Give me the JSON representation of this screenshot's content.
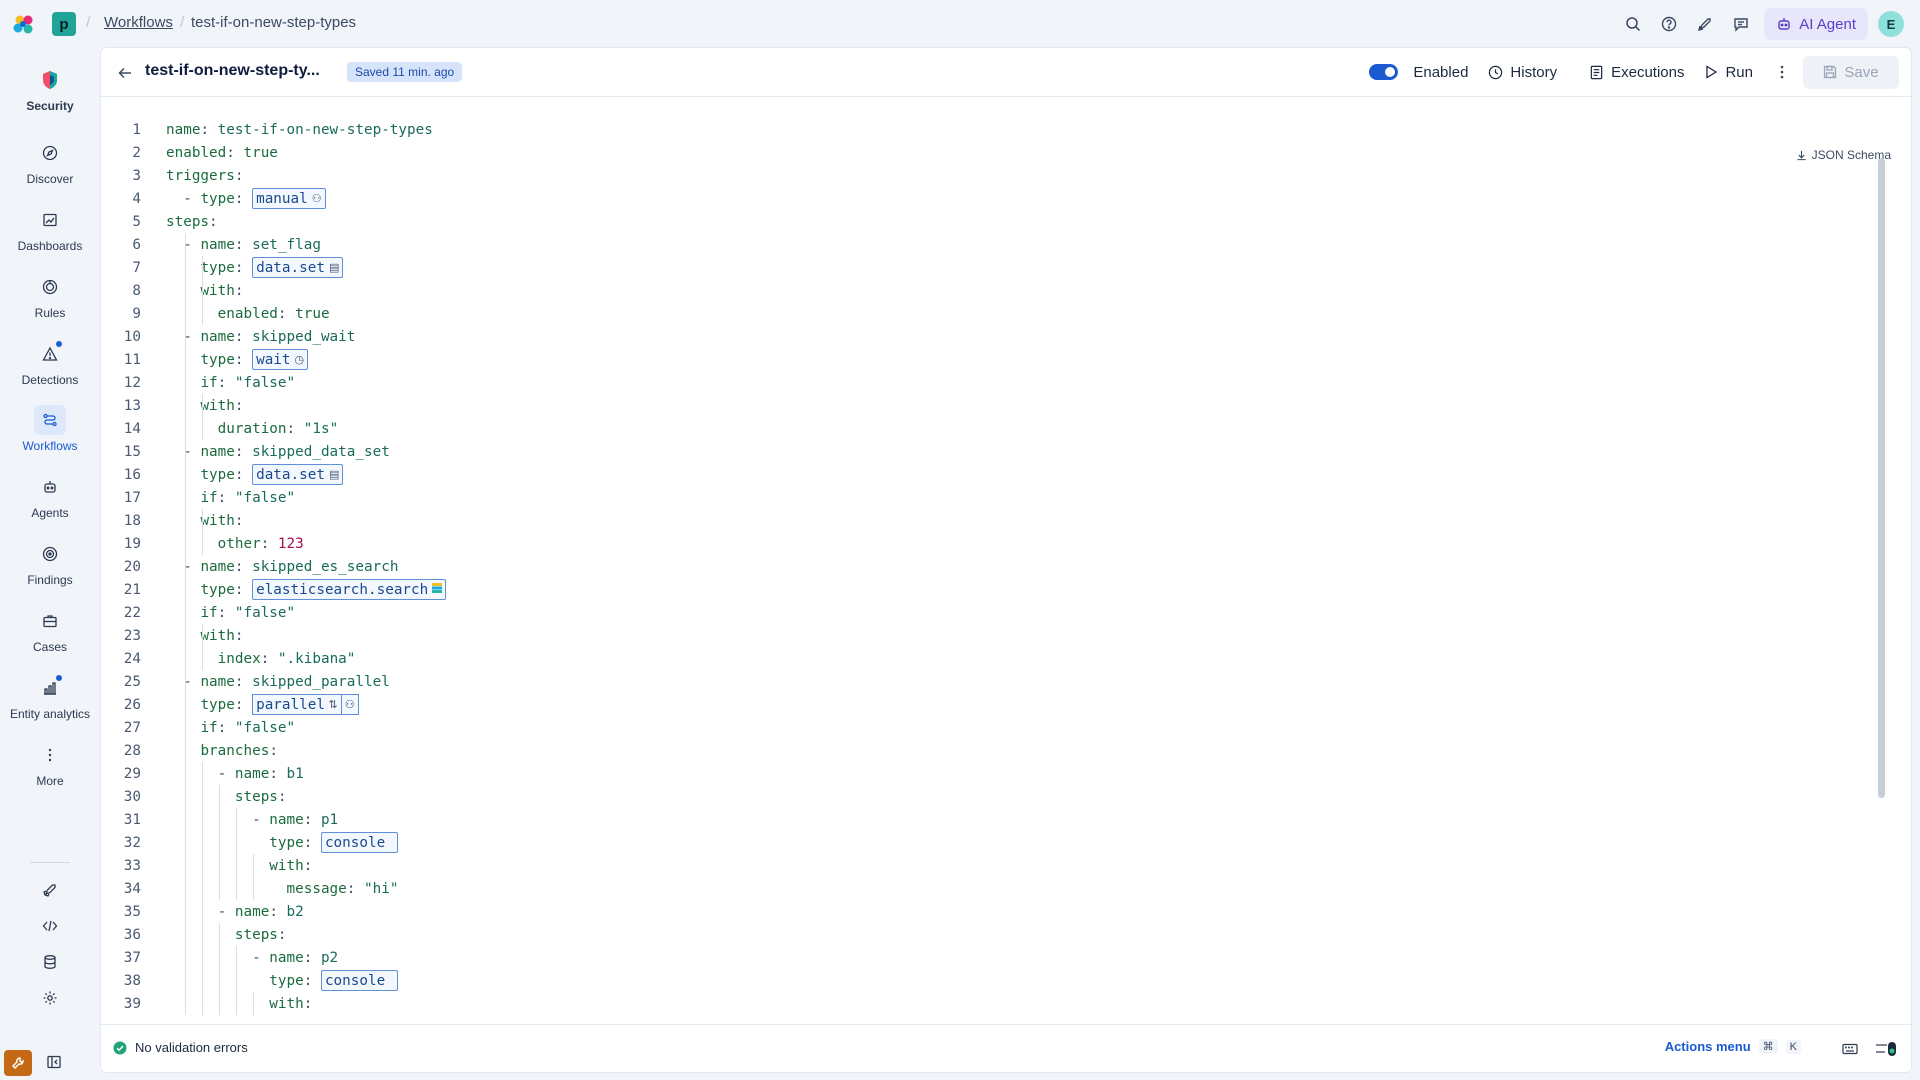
{
  "header": {
    "space_initial": "p",
    "breadcrumbs": [
      "Workflows",
      "test-if-on-new-step-types"
    ],
    "ai_agent_label": "AI Agent",
    "user_initial": "E"
  },
  "sidebar": {
    "items": [
      {
        "label": "Security",
        "icon": "security-shield-icon"
      },
      {
        "label": "Discover",
        "icon": "compass-icon"
      },
      {
        "label": "Dashboards",
        "icon": "dashboard-icon"
      },
      {
        "label": "Rules",
        "icon": "rules-icon"
      },
      {
        "label": "Detections",
        "icon": "warning-icon"
      },
      {
        "label": "Workflows",
        "icon": "workflow-icon"
      },
      {
        "label": "Agents",
        "icon": "robot-icon"
      },
      {
        "label": "Findings",
        "icon": "target-icon"
      },
      {
        "label": "Cases",
        "icon": "briefcase-icon"
      },
      {
        "label": "Entity analytics",
        "icon": "analytics-icon"
      },
      {
        "label": "More",
        "icon": "more-vertical-icon"
      }
    ],
    "active": "Workflows"
  },
  "workflow": {
    "title": "test-if-on-new-step-ty...",
    "saved_status": "Saved 11 min. ago",
    "enabled_label": "Enabled",
    "enabled": true,
    "history_label": "History",
    "executions_label": "Executions",
    "run_label": "Run",
    "save_label": "Save"
  },
  "editor": {
    "json_schema_label": "JSON Schema",
    "lines": [
      {
        "n": "1",
        "tokens": [
          [
            "k",
            "name"
          ],
          [
            "p",
            ": "
          ],
          [
            "s",
            "test-if-on-new-step-types"
          ]
        ]
      },
      {
        "n": "2",
        "tokens": [
          [
            "k",
            "enabled"
          ],
          [
            "p",
            ": "
          ],
          [
            "b",
            "true"
          ]
        ]
      },
      {
        "n": "3",
        "tokens": [
          [
            "k",
            "triggers"
          ],
          [
            "p",
            ":"
          ]
        ]
      },
      {
        "n": "4",
        "tokens": [
          [
            "p",
            "  - "
          ],
          [
            "k",
            "type"
          ],
          [
            "p",
            ": "
          ]
        ],
        "pill": "manual",
        "pill_glyph": "user"
      },
      {
        "n": "5",
        "tokens": [
          [
            "k",
            "steps"
          ],
          [
            "p",
            ":"
          ]
        ]
      },
      {
        "n": "6",
        "tokens": [
          [
            "p",
            "  - "
          ],
          [
            "k",
            "name"
          ],
          [
            "p",
            ": "
          ],
          [
            "s",
            "set_flag"
          ]
        ]
      },
      {
        "n": "7",
        "tokens": [
          [
            "p",
            "    "
          ],
          [
            "k",
            "type"
          ],
          [
            "p",
            ": "
          ]
        ],
        "pill": "data.set",
        "pill_glyph": "db"
      },
      {
        "n": "8",
        "tokens": [
          [
            "p",
            "    "
          ],
          [
            "k",
            "with"
          ],
          [
            "p",
            ":"
          ]
        ]
      },
      {
        "n": "9",
        "tokens": [
          [
            "p",
            "      "
          ],
          [
            "k",
            "enabled"
          ],
          [
            "p",
            ": "
          ],
          [
            "b",
            "true"
          ]
        ]
      },
      {
        "n": "10",
        "tokens": [
          [
            "p",
            "  - "
          ],
          [
            "k",
            "name"
          ],
          [
            "p",
            ": "
          ],
          [
            "s",
            "skipped_wait"
          ]
        ]
      },
      {
        "n": "11",
        "tokens": [
          [
            "p",
            "    "
          ],
          [
            "k",
            "type"
          ],
          [
            "p",
            ": "
          ]
        ],
        "pill": "wait",
        "pill_glyph": "clock"
      },
      {
        "n": "12",
        "tokens": [
          [
            "p",
            "    "
          ],
          [
            "k",
            "if"
          ],
          [
            "p",
            ": "
          ],
          [
            "s",
            "\"false\""
          ]
        ]
      },
      {
        "n": "13",
        "tokens": [
          [
            "p",
            "    "
          ],
          [
            "k",
            "with"
          ],
          [
            "p",
            ":"
          ]
        ]
      },
      {
        "n": "14",
        "tokens": [
          [
            "p",
            "      "
          ],
          [
            "k",
            "duration"
          ],
          [
            "p",
            ": "
          ],
          [
            "s",
            "\"1s\""
          ]
        ]
      },
      {
        "n": "15",
        "tokens": [
          [
            "p",
            "  - "
          ],
          [
            "k",
            "name"
          ],
          [
            "p",
            ": "
          ],
          [
            "s",
            "skipped_data_set"
          ]
        ]
      },
      {
        "n": "16",
        "tokens": [
          [
            "p",
            "    "
          ],
          [
            "k",
            "type"
          ],
          [
            "p",
            ": "
          ]
        ],
        "pill": "data.set",
        "pill_glyph": "db"
      },
      {
        "n": "17",
        "tokens": [
          [
            "p",
            "    "
          ],
          [
            "k",
            "if"
          ],
          [
            "p",
            ": "
          ],
          [
            "s",
            "\"false\""
          ]
        ]
      },
      {
        "n": "18",
        "tokens": [
          [
            "p",
            "    "
          ],
          [
            "k",
            "with"
          ],
          [
            "p",
            ":"
          ]
        ]
      },
      {
        "n": "19",
        "tokens": [
          [
            "p",
            "      "
          ],
          [
            "k",
            "other"
          ],
          [
            "p",
            ": "
          ],
          [
            "n",
            "123"
          ]
        ]
      },
      {
        "n": "20",
        "tokens": [
          [
            "p",
            "  - "
          ],
          [
            "k",
            "name"
          ],
          [
            "p",
            ": "
          ],
          [
            "s",
            "skipped_es_search"
          ]
        ]
      },
      {
        "n": "21",
        "tokens": [
          [
            "p",
            "    "
          ],
          [
            "k",
            "type"
          ],
          [
            "p",
            ": "
          ]
        ],
        "pill": "elasticsearch.search",
        "pill_glyph": "elastic"
      },
      {
        "n": "22",
        "tokens": [
          [
            "p",
            "    "
          ],
          [
            "k",
            "if"
          ],
          [
            "p",
            ": "
          ],
          [
            "s",
            "\"false\""
          ]
        ]
      },
      {
        "n": "23",
        "tokens": [
          [
            "p",
            "    "
          ],
          [
            "k",
            "with"
          ],
          [
            "p",
            ":"
          ]
        ]
      },
      {
        "n": "24",
        "tokens": [
          [
            "p",
            "      "
          ],
          [
            "k",
            "index"
          ],
          [
            "p",
            ": "
          ],
          [
            "s",
            "\".kibana\""
          ]
        ]
      },
      {
        "n": "25",
        "tokens": [
          [
            "p",
            "  - "
          ],
          [
            "k",
            "name"
          ],
          [
            "p",
            ": "
          ],
          [
            "s",
            "skipped_parallel"
          ]
        ]
      },
      {
        "n": "26",
        "tokens": [
          [
            "p",
            "    "
          ],
          [
            "k",
            "type"
          ],
          [
            "p",
            ": "
          ]
        ],
        "pill": "parallel",
        "pill_glyph": "parallel-split"
      },
      {
        "n": "27",
        "tokens": [
          [
            "p",
            "    "
          ],
          [
            "k",
            "if"
          ],
          [
            "p",
            ": "
          ],
          [
            "s",
            "\"false\""
          ]
        ]
      },
      {
        "n": "28",
        "tokens": [
          [
            "p",
            "    "
          ],
          [
            "k",
            "branches"
          ],
          [
            "p",
            ":"
          ]
        ]
      },
      {
        "n": "29",
        "tokens": [
          [
            "p",
            "      - "
          ],
          [
            "k",
            "name"
          ],
          [
            "p",
            ": "
          ],
          [
            "s",
            "b1"
          ]
        ]
      },
      {
        "n": "30",
        "tokens": [
          [
            "p",
            "        "
          ],
          [
            "k",
            "steps"
          ],
          [
            "p",
            ":"
          ]
        ]
      },
      {
        "n": "31",
        "tokens": [
          [
            "p",
            "          - "
          ],
          [
            "k",
            "name"
          ],
          [
            "p",
            ": "
          ],
          [
            "s",
            "p1"
          ]
        ]
      },
      {
        "n": "32",
        "tokens": [
          [
            "p",
            "            "
          ],
          [
            "k",
            "type"
          ],
          [
            "p",
            ": "
          ]
        ],
        "pill": "console ",
        "pill_glyph": ""
      },
      {
        "n": "33",
        "tokens": [
          [
            "p",
            "            "
          ],
          [
            "k",
            "with"
          ],
          [
            "p",
            ":"
          ]
        ]
      },
      {
        "n": "34",
        "tokens": [
          [
            "p",
            "              "
          ],
          [
            "k",
            "message"
          ],
          [
            "p",
            ": "
          ],
          [
            "s",
            "\"hi\""
          ]
        ]
      },
      {
        "n": "35",
        "tokens": [
          [
            "p",
            "      - "
          ],
          [
            "k",
            "name"
          ],
          [
            "p",
            ": "
          ],
          [
            "s",
            "b2"
          ]
        ]
      },
      {
        "n": "36",
        "tokens": [
          [
            "p",
            "        "
          ],
          [
            "k",
            "steps"
          ],
          [
            "p",
            ":"
          ]
        ]
      },
      {
        "n": "37",
        "tokens": [
          [
            "p",
            "          - "
          ],
          [
            "k",
            "name"
          ],
          [
            "p",
            ": "
          ],
          [
            "s",
            "p2"
          ]
        ]
      },
      {
        "n": "38",
        "tokens": [
          [
            "p",
            "            "
          ],
          [
            "k",
            "type"
          ],
          [
            "p",
            ": "
          ]
        ],
        "pill": "console ",
        "pill_glyph": ""
      },
      {
        "n": "39",
        "tokens": [
          [
            "p",
            "            "
          ],
          [
            "k",
            "with"
          ],
          [
            "p",
            ":"
          ]
        ]
      }
    ]
  },
  "footer": {
    "validation_text": "No validation errors",
    "actions_menu_label": "Actions menu",
    "shortcut_keys": [
      "⌘",
      "K"
    ]
  },
  "colors": {
    "accent": "#1b5bd1",
    "code_key": "#1b6b3e",
    "code_number": "#a5114e",
    "saved_badge_bg": "#d6e4fb"
  }
}
